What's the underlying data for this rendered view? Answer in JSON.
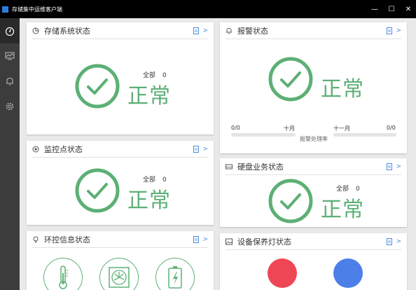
{
  "window": {
    "title": "存储集中运维客户端",
    "controls": [
      "—",
      "☐",
      "✕"
    ]
  },
  "sidebar": {
    "items": [
      {
        "name": "dashboard",
        "icon": "speedometer-icon",
        "active": true
      },
      {
        "name": "monitor",
        "icon": "monitor-chart-icon",
        "active": false
      },
      {
        "name": "alarm",
        "icon": "bell-icon",
        "active": false
      },
      {
        "name": "settings",
        "icon": "gear-icon",
        "active": false
      }
    ]
  },
  "cards": {
    "storage": {
      "title": "存储系统状态",
      "total_label": "全部",
      "total_value": "0",
      "status": "正常"
    },
    "alarm": {
      "title": "报警状态",
      "status": "正常",
      "left_ratio": "0/0",
      "month_label": "十月",
      "next_month_label": "十一月",
      "right_ratio": "0/0",
      "caption": "报警处理率"
    },
    "monitor": {
      "title": "监控点状态",
      "total_label": "全部",
      "total_value": "0",
      "status": "正常"
    },
    "disk": {
      "title": "硬盘业务状态",
      "total_label": "全部",
      "total_value": "0",
      "status": "正常"
    },
    "env": {
      "title": "环控信息状态",
      "icons": [
        "thermometer-icon",
        "fan-icon",
        "battery-charging-icon"
      ]
    },
    "lamp": {
      "title": "设备保养灯状态",
      "lamps": [
        "#ef4655",
        "#4d7fe8"
      ]
    }
  },
  "more_symbol": ">",
  "colors": {
    "ok_green": "#5cb075",
    "link_blue": "#4a8be0",
    "sidebar_bg": "#3c3c3c",
    "titlebar_bg": "#000000"
  }
}
